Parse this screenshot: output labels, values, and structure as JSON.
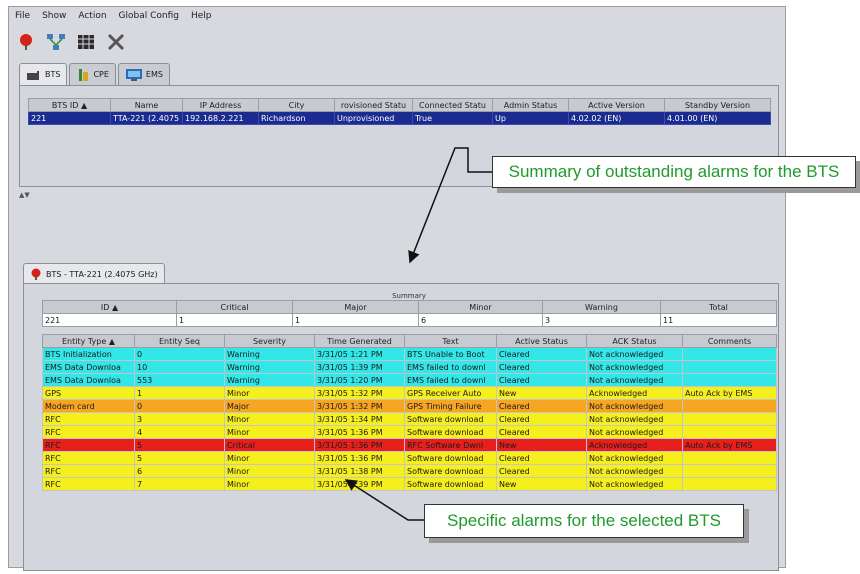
{
  "menu": [
    "File",
    "Show",
    "Action",
    "Global Config",
    "Help"
  ],
  "toolbar": [
    {
      "icon": "alarm-bell-icon"
    },
    {
      "icon": "topology-icon"
    },
    {
      "icon": "grid-icon"
    },
    {
      "icon": "tools-icon"
    }
  ],
  "tabs": [
    {
      "label": "BTS",
      "icon": "bts-icon"
    },
    {
      "label": "CPE",
      "icon": "cpe-icon"
    },
    {
      "label": "EMS",
      "icon": "ems-icon"
    }
  ],
  "bts_table": {
    "columns": [
      "BTS ID",
      "Name",
      "IP Address",
      "City",
      "rovisioned Statu",
      "Connected Statu",
      "Admin Status",
      "Active Version",
      "Standby Version"
    ],
    "sorted_indicator": "▲",
    "rows": [
      [
        "221",
        "TTA-221 (2.4075",
        "192.168.2.221",
        "Richardson",
        "Unprovisioned",
        "True",
        "Up",
        "4.02.02 (EN)",
        "4.01.00 (EN)"
      ]
    ]
  },
  "splitter_label": "▲▼",
  "detail_tab": {
    "label": "BTS - TTA-221 (2.4075 GHz)"
  },
  "summary": {
    "title": "Summary",
    "columns": [
      "ID",
      "Critical",
      "Major",
      "Minor",
      "Warning",
      "Total"
    ],
    "sorted_indicator": "▲",
    "row": [
      "221",
      "1",
      "1",
      "6",
      "3",
      "11"
    ]
  },
  "alarms": {
    "columns": [
      "Entity Type",
      "Entity Seq",
      "Severity",
      "Time Generated",
      "Text",
      "Active Status",
      "ACK Status",
      "Comments"
    ],
    "sorted_indicator": "▲",
    "rows": [
      {
        "cells": [
          "BTS Initialization",
          "0",
          "Warning",
          "3/31/05 1:21 PM",
          "BTS Unable to Boot",
          "Cleared",
          "Not acknowledged",
          ""
        ],
        "color": "#33e6e8"
      },
      {
        "cells": [
          "EMS Data Downloa",
          "10",
          "Warning",
          "3/31/05 1:39 PM",
          "EMS failed to downl",
          "Cleared",
          "Not acknowledged",
          ""
        ],
        "color": "#33e6e8"
      },
      {
        "cells": [
          "EMS Data Downloa",
          "553",
          "Warning",
          "3/31/05 1:20 PM",
          "EMS failed to downl",
          "Cleared",
          "Not acknowledged",
          ""
        ],
        "color": "#33e6e8"
      },
      {
        "cells": [
          "GPS",
          "1",
          "Minor",
          "3/31/05 1:32 PM",
          "GPS Receiver Auto",
          "New",
          "Acknowledged",
          "Auto Ack by EMS"
        ],
        "color": "#f5ef1e"
      },
      {
        "cells": [
          "Modem card",
          "0",
          "Major",
          "3/31/05 1:32 PM",
          "GPS Timing Failure",
          "Cleared",
          "Not acknowledged",
          ""
        ],
        "color": "#f6a623"
      },
      {
        "cells": [
          "RFC",
          "3",
          "Minor",
          "3/31/05 1:34 PM",
          "Software download",
          "Cleared",
          "Not acknowledged",
          ""
        ],
        "color": "#f5ef1e"
      },
      {
        "cells": [
          "RFC",
          "4",
          "Minor",
          "3/31/05 1:36 PM",
          "Software download",
          "Cleared",
          "Not acknowledged",
          ""
        ],
        "color": "#f5ef1e"
      },
      {
        "cells": [
          "RFC",
          "5",
          "Critical",
          "3/31/05 1:36 PM",
          "RFC Software Dwnl",
          "New",
          "Acknowledged",
          "Auto Ack by EMS"
        ],
        "color": "#e8201c"
      },
      {
        "cells": [
          "RFC",
          "5",
          "Minor",
          "3/31/05 1:36 PM",
          "Software download",
          "Cleared",
          "Not acknowledged",
          ""
        ],
        "color": "#f5ef1e"
      },
      {
        "cells": [
          "RFC",
          "6",
          "Minor",
          "3/31/05 1:38 PM",
          "Software download",
          "Cleared",
          "Not acknowledged",
          ""
        ],
        "color": "#f5ef1e"
      },
      {
        "cells": [
          "RFC",
          "7",
          "Minor",
          "3/31/05 1:39 PM",
          "Software download",
          "New",
          "Not acknowledged",
          ""
        ],
        "color": "#f5ef1e"
      }
    ]
  },
  "callouts": {
    "summary": "Summary of outstanding alarms for the BTS",
    "specific": "Specific alarms for the selected BTS",
    "color": "#1f9b2d"
  }
}
